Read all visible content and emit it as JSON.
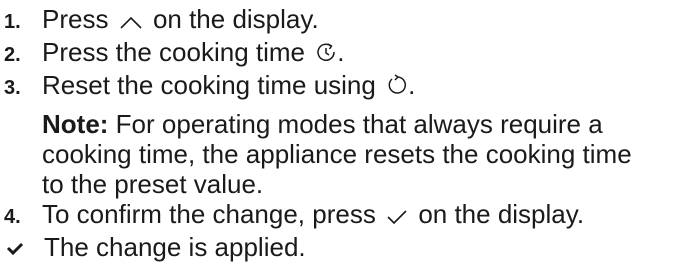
{
  "steps": [
    {
      "number": "1.",
      "before": "Press",
      "icon": "chevron-up-icon",
      "after": "on the display."
    },
    {
      "number": "2.",
      "before": "Press the cooking time",
      "icon": "cooking-time-icon",
      "after": "."
    },
    {
      "number": "3.",
      "before": "Reset the cooking time using",
      "icon": "reset-icon",
      "after": "."
    },
    {
      "number": "4.",
      "before": "To confirm the change, press",
      "icon": "checkmark-icon",
      "after": "on the display."
    }
  ],
  "note": {
    "label": "Note:",
    "line1": "For operating modes that always require a",
    "line2": "cooking time, the appliance resets the cooking time",
    "line3": "to the preset value."
  },
  "result": {
    "icon": "result-check-icon",
    "text": "The change is applied."
  }
}
